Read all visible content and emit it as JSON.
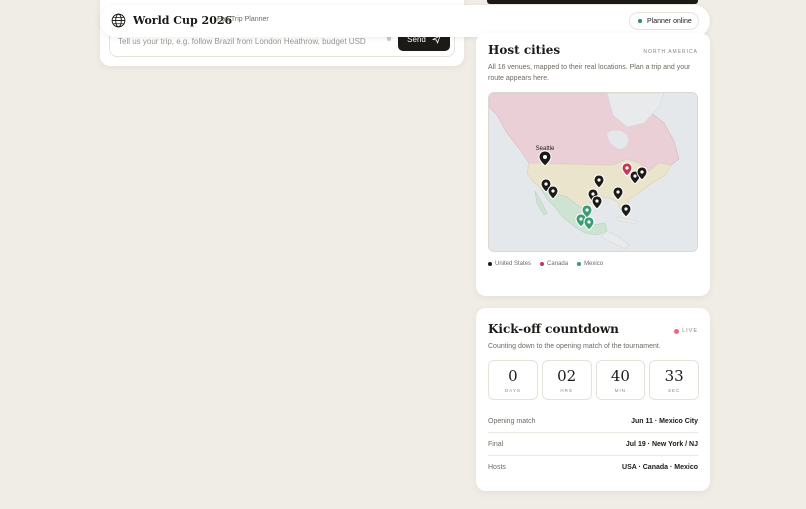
{
  "header": {
    "brand": "World Cup 2026",
    "subtitle": "Fan Trip Planner",
    "status": "Planner online",
    "status_color": "#2e8b62"
  },
  "chat": {
    "placeholder": "Tell us your trip, e.g. follow Brazil from London Heathrow, budget USD",
    "send_label": "Send"
  },
  "hosts": {
    "title": "Host cities",
    "region": "NORTH AMERICA",
    "description": "All 16 venues, mapped to their real locations. Plan a trip and your route appears here.",
    "highlighted_city": "Seattle",
    "legend": [
      {
        "label": "United States",
        "color": "#1c1a17"
      },
      {
        "label": "Canada",
        "color": "#c23a5a"
      },
      {
        "label": "Mexico",
        "color": "#3a9c72"
      }
    ]
  },
  "countdown": {
    "title": "Kick-off countdown",
    "live_label": "LIVE",
    "description": "Counting down to the opening match of the tournament.",
    "units": [
      {
        "value": "0",
        "label": "DAYS"
      },
      {
        "value": "02",
        "label": "HRS"
      },
      {
        "value": "40",
        "label": "MIN"
      },
      {
        "value": "33",
        "label": "SEC"
      }
    ],
    "info": [
      {
        "label": "Opening match",
        "value": "Jun 11 · Mexico City"
      },
      {
        "label": "Final",
        "value": "Jul 19 · New York / NJ"
      },
      {
        "label": "Hosts",
        "value": "USA · Canada · Mexico"
      }
    ]
  }
}
